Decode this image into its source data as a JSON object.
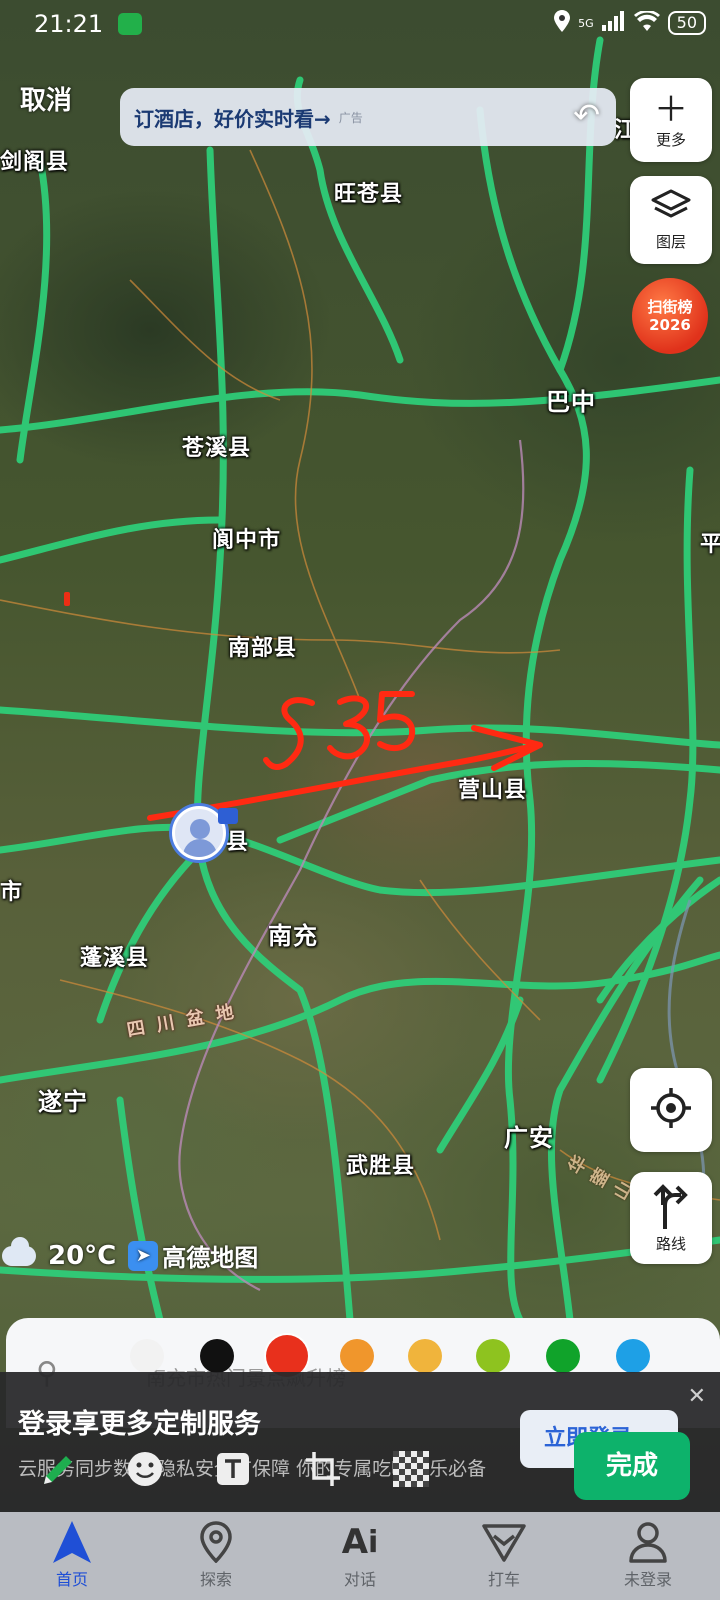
{
  "status_bar": {
    "time": "21:21",
    "network": "5G",
    "battery": "50"
  },
  "top": {
    "cancel_label": "取消",
    "ad_text": "订酒店，好价实时看→",
    "ad_tag": "广告"
  },
  "side_buttons": {
    "more_label": "更多",
    "layer_label": "图层",
    "scan_line1": "扫街榜",
    "scan_line2": "2026",
    "route_label": "路线"
  },
  "map": {
    "places": [
      {
        "id": "jiange",
        "name": "剑阁县"
      },
      {
        "id": "wangcang",
        "name": "旺苍县"
      },
      {
        "id": "bazhong",
        "name": "巴中"
      },
      {
        "id": "cangxi",
        "name": "苍溪县"
      },
      {
        "id": "langzhong",
        "name": "阆中市"
      },
      {
        "id": "nanbu",
        "name": "南部县"
      },
      {
        "id": "yingshan",
        "name": "营山县"
      },
      {
        "id": "nanchong",
        "name": "南充"
      },
      {
        "id": "pengxi",
        "name": "蓬溪县"
      },
      {
        "id": "suining",
        "name": "遂宁"
      },
      {
        "id": "guangan",
        "name": "广安"
      },
      {
        "id": "wusheng",
        "name": "武胜县"
      },
      {
        "id": "edge_right",
        "name": "平"
      },
      {
        "id": "edge_left",
        "name": "市"
      },
      {
        "id": "edge_top",
        "name": "江"
      },
      {
        "id": "xi_county",
        "name": "县"
      }
    ],
    "basin_label": "四川盆地",
    "mountain_label": "华蓥山",
    "annotation_text": "S35"
  },
  "weather": {
    "temperature": "20°C",
    "brand": "高德地图"
  },
  "search_sheet": {
    "hint": "南充市热门景点飙升榜"
  },
  "colors": [
    "#f2f2f2",
    "#111111",
    "#e8301c",
    "#f0962c",
    "#f0b43c",
    "#8ec31f",
    "#10a32a",
    "#1ea0e6"
  ],
  "login_banner": {
    "title": "登录享更多定制服务",
    "subtitle": "云服务同步数据 隐私安全有保障 你的专属吃喝玩乐必备",
    "button": "立即登录"
  },
  "draw": {
    "done_label": "完成"
  },
  "tabs": [
    {
      "label": "首页",
      "icon": "navigation-arrow-icon"
    },
    {
      "label": "探索",
      "icon": "location-pin-icon"
    },
    {
      "label": "对话",
      "icon": "ai-sparkle-icon"
    },
    {
      "label": "打车",
      "icon": "taxi-icon"
    },
    {
      "label": "未登录",
      "icon": "user-icon"
    }
  ]
}
